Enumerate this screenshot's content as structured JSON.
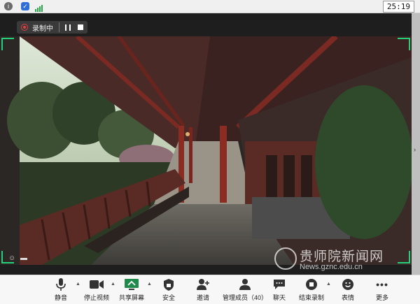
{
  "statusbar": {
    "time": "25:19"
  },
  "recording": {
    "label": "录制中"
  },
  "watermark": {
    "text": "贵师院新闻网",
    "url": "News.gznc.edu.cn"
  },
  "toolbar": {
    "mute": "静音",
    "stop_video": "停止视频",
    "share_screen": "共享屏幕",
    "security": "安全",
    "invite": "邀请",
    "participants": "管理成员（40）",
    "chat": "聊天",
    "end_recording": "结束录制",
    "reactions": "表情",
    "more": "更多"
  },
  "colors": {
    "accent_green": "#24d07a",
    "record_red": "#e04040"
  }
}
